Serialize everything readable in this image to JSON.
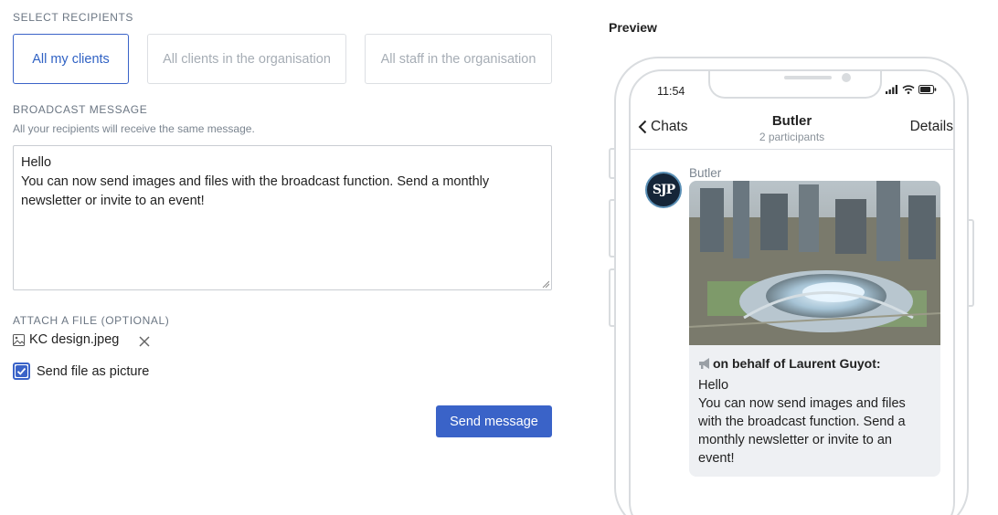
{
  "recipients": {
    "label": "SELECT RECIPIENTS",
    "options": [
      {
        "label": "All my clients",
        "selected": true
      },
      {
        "label": "All clients in the organisation",
        "selected": false
      },
      {
        "label": "All staff in the organisation",
        "selected": false
      }
    ]
  },
  "broadcast": {
    "label": "BROADCAST MESSAGE",
    "hint": "All your recipients will receive the same message.",
    "lines": [
      "Hello",
      "You can now send images and files with the broadcast function. Send a monthly",
      "newsletter or invite to an event!"
    ]
  },
  "attach": {
    "label": "ATTACH A FILE (OPTIONAL)",
    "file_name": "KC design.jpeg",
    "file_icon": "image-icon",
    "send_as_picture_label": "Send file as picture",
    "send_as_picture_checked": true
  },
  "actions": {
    "send_label": "Send message"
  },
  "preview": {
    "title": "Preview",
    "status_time": "11:54",
    "header": {
      "back_label": "Chats",
      "title": "Butler",
      "subtitle": "2 participants",
      "details_label": "Details"
    },
    "message": {
      "sender": "Butler",
      "avatar_text": "SJP",
      "on_behalf": "on behalf of Laurent Guyot:",
      "lines": [
        "Hello",
        "You can now send images and files",
        "with the broadcast function. Send a",
        "monthly newsletter or invite to an",
        "event!"
      ]
    }
  },
  "colors": {
    "accent": "#3a63c8",
    "muted_text": "#6b7683",
    "bubble_bg": "#eef0f3"
  }
}
